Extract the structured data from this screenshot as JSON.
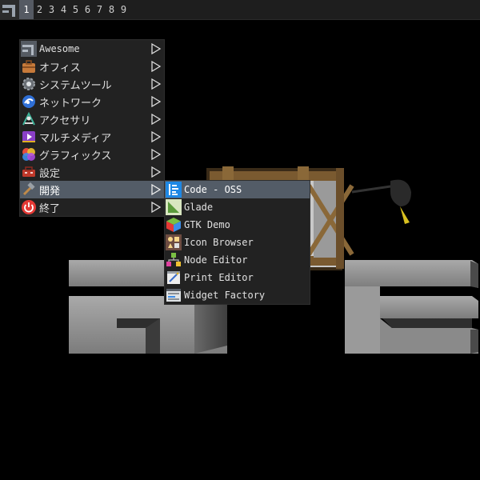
{
  "topbar": {
    "tags": [
      "1",
      "2",
      "3",
      "4",
      "5",
      "6",
      "7",
      "8",
      "9"
    ],
    "active_tag": "1"
  },
  "main_menu": {
    "items": [
      {
        "label": "Awesome",
        "icon": "awesome-icon"
      },
      {
        "label": "オフィス",
        "icon": "briefcase-icon"
      },
      {
        "label": "システムツール",
        "icon": "gear-icon"
      },
      {
        "label": "ネットワーク",
        "icon": "network-globe-icon"
      },
      {
        "label": "アクセサリ",
        "icon": "accessories-icon"
      },
      {
        "label": "マルチメディア",
        "icon": "multimedia-icon"
      },
      {
        "label": "グラフィックス",
        "icon": "graphics-icon"
      },
      {
        "label": "設定",
        "icon": "settings-toolbox-icon"
      },
      {
        "label": "開発",
        "icon": "hammer-icon"
      },
      {
        "label": "終了",
        "icon": "power-icon"
      }
    ],
    "selected_index": 8
  },
  "sub_menu": {
    "items": [
      {
        "label": "Code - OSS",
        "icon": "code-oss-icon"
      },
      {
        "label": "Glade",
        "icon": "glade-icon"
      },
      {
        "label": "GTK Demo",
        "icon": "gtk-demo-icon"
      },
      {
        "label": "Icon Browser",
        "icon": "icon-browser-icon"
      },
      {
        "label": "Node Editor",
        "icon": "node-editor-icon"
      },
      {
        "label": "Print Editor",
        "icon": "print-editor-icon"
      },
      {
        "label": "Widget Factory",
        "icon": "widget-factory-icon"
      }
    ],
    "selected_index": 0
  },
  "colors": {
    "menu_bg": "#222222",
    "selected_bg": "#535c67",
    "text": "#e0e0e0",
    "topbar_bg": "#1e1e1e"
  }
}
